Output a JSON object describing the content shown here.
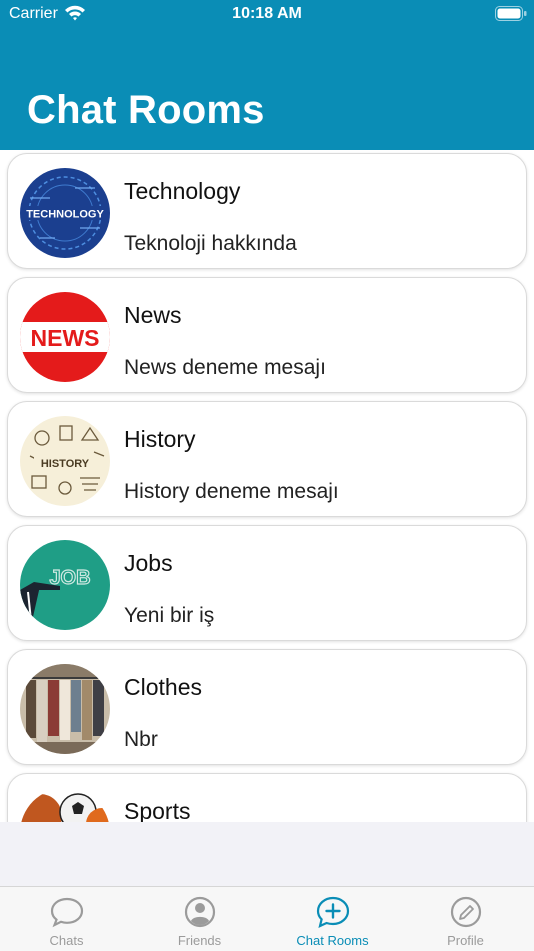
{
  "status_bar": {
    "carrier": "Carrier",
    "time": "10:18 AM"
  },
  "header": {
    "title": "Chat Rooms"
  },
  "rooms": [
    {
      "name": "Technology",
      "message": "Teknoloji hakkında",
      "avatar_text": "TECHNOLOGY"
    },
    {
      "name": "News",
      "message": "News deneme mesajı",
      "avatar_text": "NEWS"
    },
    {
      "name": "History",
      "message": "History deneme mesajı",
      "avatar_text": "HISTORY"
    },
    {
      "name": "Jobs",
      "message": "Yeni bir iş",
      "avatar_text": "JOB"
    },
    {
      "name": "Clothes",
      "message": "Nbr",
      "avatar_text": ""
    },
    {
      "name": "Sports",
      "message": "",
      "avatar_text": ""
    }
  ],
  "tabs": [
    {
      "label": "Chats",
      "icon": "chat-bubble-icon",
      "active": false
    },
    {
      "label": "Friends",
      "icon": "person-circle-icon",
      "active": false
    },
    {
      "label": "Chat Rooms",
      "icon": "plus-bubble-icon",
      "active": true
    },
    {
      "label": "Profile",
      "icon": "pencil-circle-icon",
      "active": false
    }
  ],
  "colors": {
    "accent": "#0a8db6",
    "inactive_tab": "#9b9b9b",
    "background": "#f2f2f7"
  }
}
